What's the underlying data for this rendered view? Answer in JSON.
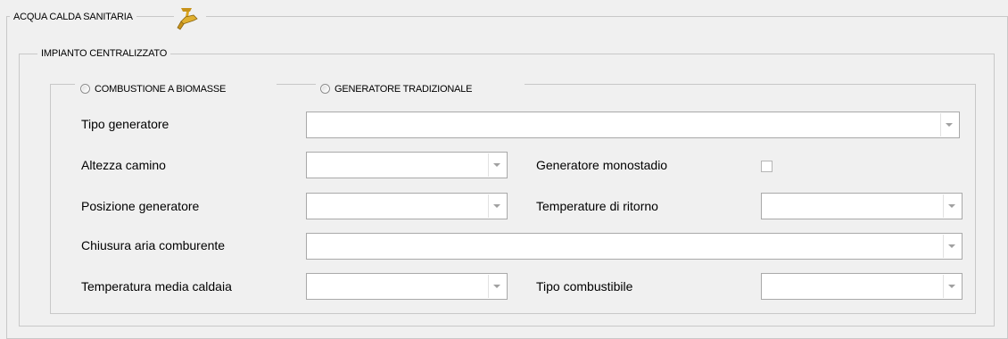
{
  "section": {
    "title": "ACQUA CALDA SANITARIA",
    "icon": "faucet-icon"
  },
  "group": {
    "title": "IMPIANTO CENTRALIZZATO"
  },
  "options": [
    {
      "label": "COMBUSTIONE A BIOMASSE",
      "selected": false
    },
    {
      "label": "GENERATORE TRADIZIONALE",
      "selected": false
    }
  ],
  "fields": {
    "tipo_generatore": {
      "label": "Tipo generatore",
      "value": ""
    },
    "altezza_camino": {
      "label": "Altezza camino",
      "value": ""
    },
    "generatore_monostadio": {
      "label": "Generatore monostadio",
      "checked": false
    },
    "posizione_generatore": {
      "label": "Posizione generatore",
      "value": ""
    },
    "temperature_ritorno": {
      "label": "Temperature di ritorno",
      "value": ""
    },
    "chiusura_aria": {
      "label": "Chiusura aria comburente",
      "value": ""
    },
    "temperatura_media": {
      "label": "Temperatura media caldaia",
      "value": ""
    },
    "tipo_combustibile": {
      "label": "Tipo combustibile",
      "value": ""
    }
  },
  "colors": {
    "background": "#f0f0f0",
    "border": "#c8c8c8",
    "field_border": "#a9a9a9",
    "icon": "#d9a520"
  }
}
